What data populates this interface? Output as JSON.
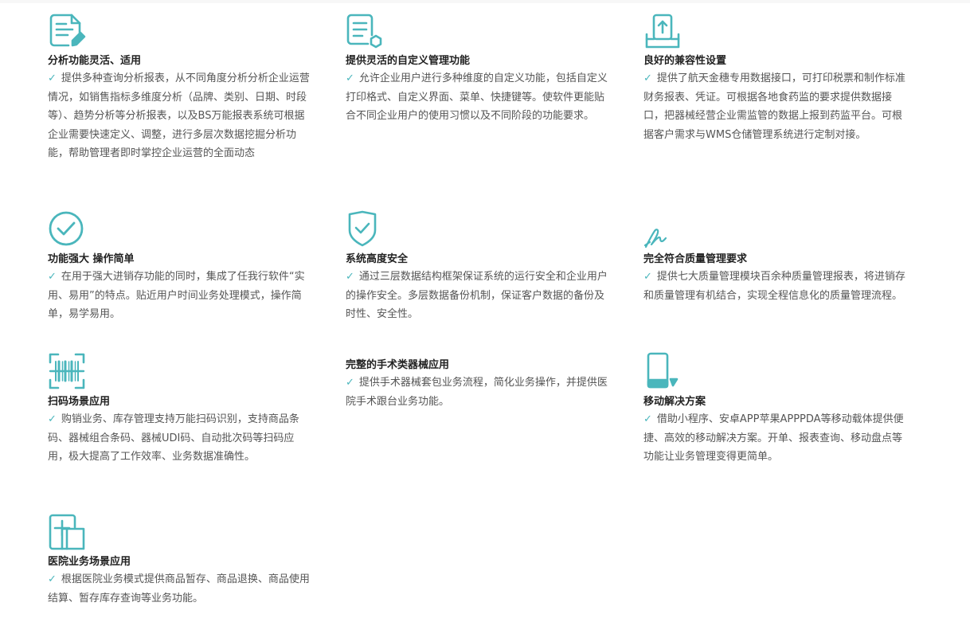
{
  "accent_color": "#4ab6bc",
  "features": [
    {
      "title": "分析功能灵活、适用",
      "icon": "report-edit-icon",
      "desc": "提供多种查询分析报表，从不同角度分析分析企业运营情况，如销售指标多维度分析（品牌、类别、日期、时段等）、趋势分析等分析报表，以及BS万能报表系统可根据企业需要快速定义、调整，进行多层次数据挖掘分析功能，帮助管理者即时掌控企业运营的全面动态"
    },
    {
      "title": "提供灵活的自定义管理功能",
      "icon": "document-settings-icon",
      "desc": "允许企业用户进行多种维度的自定义功能，包括自定义打印格式、自定义界面、菜单、快捷键等。使软件更能贴合不同企业用户的使用习惯以及不同阶段的功能要求。"
    },
    {
      "title": "良好的兼容性设置",
      "icon": "upload-tray-icon",
      "desc": "提供了航天金穗专用数据接口，可打印税票和制作标准财务报表、凭证。可根据各地食药监的要求提供数据接口，把器械经营企业需监管的数据上报到药监平台。可根据客户需求与WMS仓储管理系统进行定制对接。"
    },
    {
      "title": "功能强大 操作简单",
      "icon": "check-circle-icon",
      "desc": "在用于强大进销存功能的同时，集成了任我行软件“实用、易用”的特点。贴近用户时间业务处理模式，操作简单，易学易用。"
    },
    {
      "title": "系统高度安全",
      "icon": "shield-check-icon",
      "desc": "通过三层数据结构框架保证系统的运行安全和企业用户的操作安全。多层数据备份机制，保证客户数据的备份及时性、安全性。"
    },
    {
      "title": "完全符合质量管理要求",
      "icon": "signature-icon",
      "desc": "提供七大质量管理模块百余种质量管理报表，将进销存和质量管理有机结合，实现全程信息化的质量管理流程。"
    },
    {
      "title": "扫码场景应用",
      "icon": "barcode-scan-icon",
      "desc": "购销业务、库存管理支持万能扫码识别，支持商品条码、器械组合条码、器械UDI码、自动批次码等扫码应用，极大提高了工作效率、业务数据准确性。"
    },
    {
      "title": "完整的手术类器械应用",
      "icon": "",
      "desc": "提供手术器械套包业务流程，简化业务操作，并提供医院手术跟台业务功能。"
    },
    {
      "title": "移动解决方案",
      "icon": "mobile-phone-icon",
      "desc": "借助小程序、安卓APP苹果APPPDA等移动载体提供便捷、高效的移动解决方案。开单、报表查询、移动盘点等功能让业务管理变得更简单。"
    },
    {
      "title": "医院业务场景应用",
      "icon": "medical-document-icon",
      "desc": "根据医院业务模式提供商品暂存、商品退换、商品使用结算、暂存库存查询等业务功能。"
    }
  ]
}
